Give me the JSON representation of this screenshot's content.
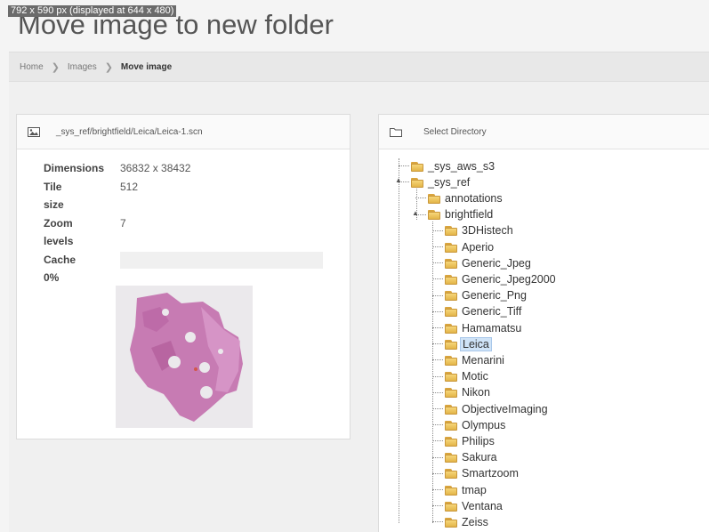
{
  "overlay_label": "792 x 590 px (displayed at 644 x 480)",
  "page_title": "Move image to new folder",
  "breadcrumb": {
    "items": [
      "Home",
      "Images"
    ],
    "current": "Move image"
  },
  "image_panel": {
    "icon": "image-icon",
    "path": "_sys_ref/brightfield/Leica/Leica-1.scn",
    "dimensions_label": "Dimensions",
    "dimensions_value": "36832 x 38432",
    "tile_label_1": "Tile",
    "tile_label_2": "size",
    "tile_value": "512",
    "zoom_label_1": "Zoom",
    "zoom_label_2": "levels",
    "zoom_value": "7",
    "cache_label": "Cache",
    "cache_percent_label": "0%",
    "cache_progress": 0
  },
  "directory_panel": {
    "icon": "folder-outline-icon",
    "title": "Select Directory",
    "tree": [
      {
        "label": "_sys_aws_s3",
        "level": 0
      },
      {
        "label": "_sys_ref",
        "level": 0,
        "expanded": true
      },
      {
        "label": "annotations",
        "level": 1
      },
      {
        "label": "brightfield",
        "level": 1,
        "expanded": true
      },
      {
        "label": "3DHistech",
        "level": 2
      },
      {
        "label": "Aperio",
        "level": 2
      },
      {
        "label": "Generic_Jpeg",
        "level": 2
      },
      {
        "label": "Generic_Jpeg2000",
        "level": 2
      },
      {
        "label": "Generic_Png",
        "level": 2
      },
      {
        "label": "Generic_Tiff",
        "level": 2
      },
      {
        "label": "Hamamatsu",
        "level": 2
      },
      {
        "label": "Leica",
        "level": 2,
        "selected": true
      },
      {
        "label": "Menarini",
        "level": 2
      },
      {
        "label": "Motic",
        "level": 2
      },
      {
        "label": "Nikon",
        "level": 2
      },
      {
        "label": "ObjectiveImaging",
        "level": 2
      },
      {
        "label": "Olympus",
        "level": 2
      },
      {
        "label": "Philips",
        "level": 2
      },
      {
        "label": "Sakura",
        "level": 2
      },
      {
        "label": "Smartzoom",
        "level": 2
      },
      {
        "label": "tmap",
        "level": 2
      },
      {
        "label": "Ventana",
        "level": 2
      },
      {
        "label": "Zeiss",
        "level": 2
      }
    ]
  },
  "colors": {
    "selected_bg": "#cfe3f7",
    "folder": "#e3b548",
    "tissue": "#c77bb3"
  }
}
